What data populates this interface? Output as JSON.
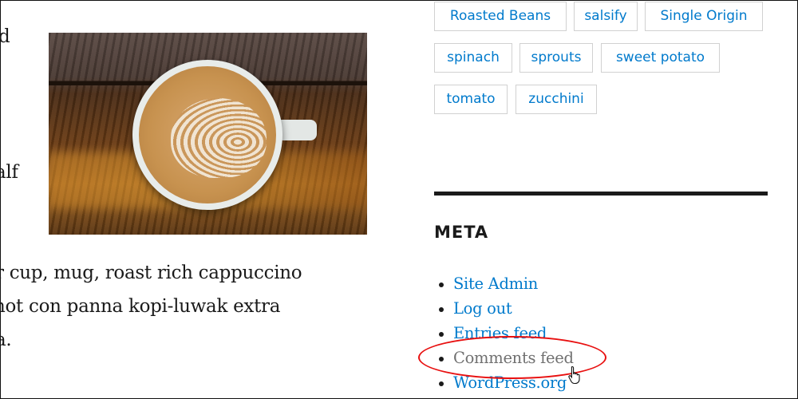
{
  "article": {
    "line_fragments": [
      "d",
      "alf"
    ],
    "paragraph_lines": [
      "r cup, mug, roast rich cappuccino",
      "hot con panna kopi-luwak extra",
      "a."
    ],
    "image": {
      "subject": "latte-art-coffee-cup"
    }
  },
  "sidebar": {
    "tags": [
      {
        "label": "Roasted Beans"
      },
      {
        "label": "salsify"
      },
      {
        "label": "Single Origin"
      },
      {
        "label": "spinach"
      },
      {
        "label": "sprouts"
      },
      {
        "label": "sweet potato"
      },
      {
        "label": "tomato"
      },
      {
        "label": "zucchini"
      }
    ],
    "meta": {
      "title": "META",
      "links": [
        {
          "label": "Site Admin"
        },
        {
          "label": "Log out"
        },
        {
          "label": "Entries feed"
        },
        {
          "label": "Comments feed",
          "state": "hovered"
        },
        {
          "label": "WordPress.org"
        }
      ]
    }
  },
  "annotation": {
    "highlight": "Comments feed",
    "color": "#e81010",
    "cursor": "hand-pointer-icon"
  },
  "colors": {
    "link": "#007acc",
    "link_hover": "#707070",
    "text": "#1a1a1a"
  }
}
